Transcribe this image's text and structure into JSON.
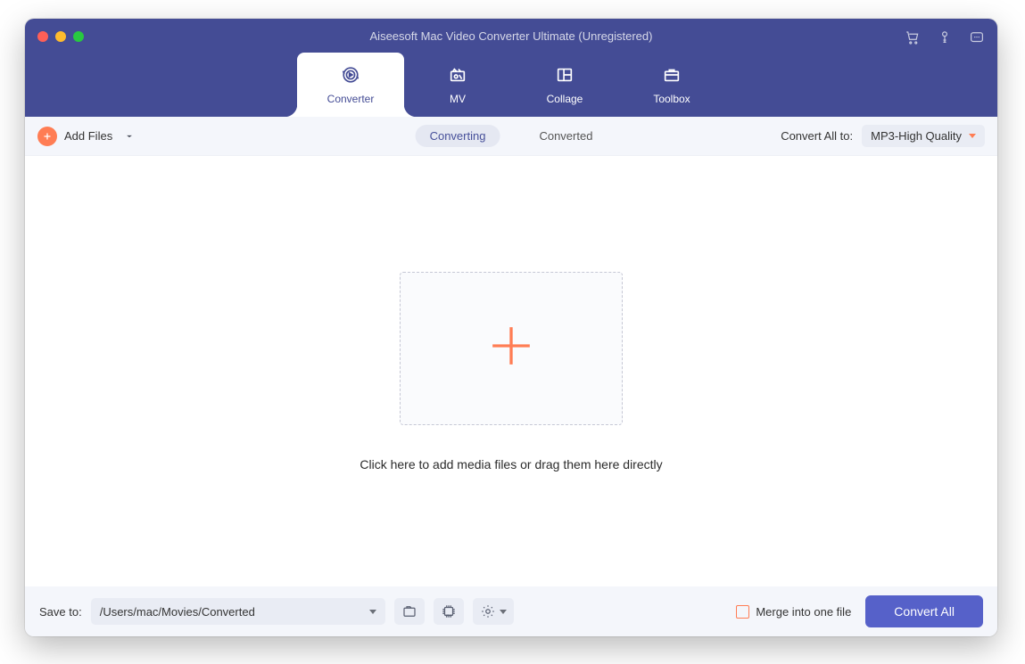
{
  "window": {
    "title": "Aiseesoft Mac Video Converter Ultimate (Unregistered)"
  },
  "tabs": [
    {
      "label": "Converter",
      "active": true,
      "icon": "convert-icon"
    },
    {
      "label": "MV",
      "active": false,
      "icon": "mv-icon"
    },
    {
      "label": "Collage",
      "active": false,
      "icon": "collage-icon"
    },
    {
      "label": "Toolbox",
      "active": false,
      "icon": "toolbox-icon"
    }
  ],
  "subbar": {
    "add_files_label": "Add Files",
    "segments": {
      "converting": "Converting",
      "converted": "Converted",
      "active": "converting"
    },
    "convert_all_label": "Convert All to:",
    "format_value": "MP3-High Quality"
  },
  "dropzone": {
    "hint": "Click here to add media files or drag them here directly"
  },
  "bottom": {
    "save_to_label": "Save to:",
    "save_path": "/Users/mac/Movies/Converted",
    "merge_label": "Merge into one file",
    "merge_checked": false,
    "convert_button": "Convert All"
  },
  "title_icons": {
    "cart": "cart-icon",
    "key": "key-icon",
    "feedback": "feedback-icon"
  }
}
